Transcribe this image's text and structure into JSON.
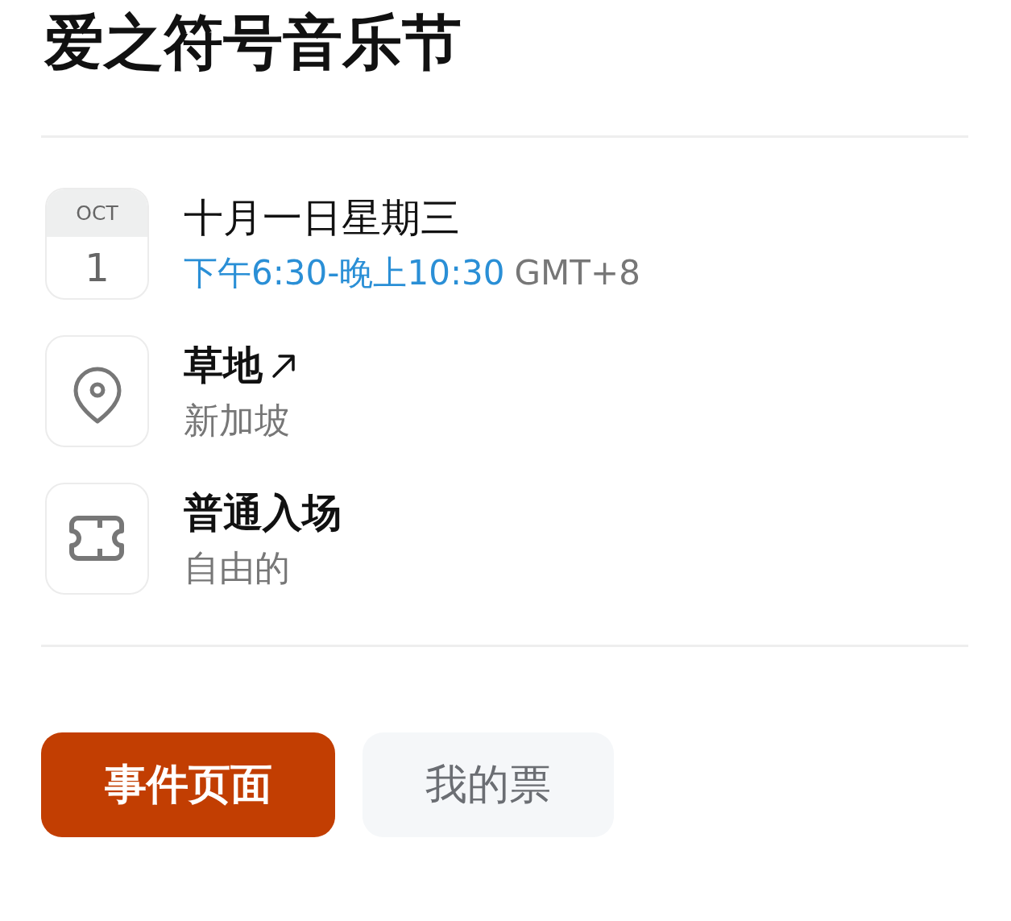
{
  "title": "爱之符号音乐节",
  "date": {
    "month": "OCT",
    "day": "1",
    "label": "十月一日星期三",
    "time_range": "下午6:30-晚上10:30",
    "timezone": "GMT+8"
  },
  "details": [
    {
      "kind": "location",
      "title": "草地",
      "subtitle": "新加坡",
      "link": true
    },
    {
      "kind": "ticket",
      "title": "普通入场",
      "subtitle": "自由的",
      "link": false
    }
  ],
  "buttons": [
    {
      "label": "事件页面",
      "kind": "primary"
    },
    {
      "label": "我的票",
      "kind": "secondary"
    }
  ]
}
